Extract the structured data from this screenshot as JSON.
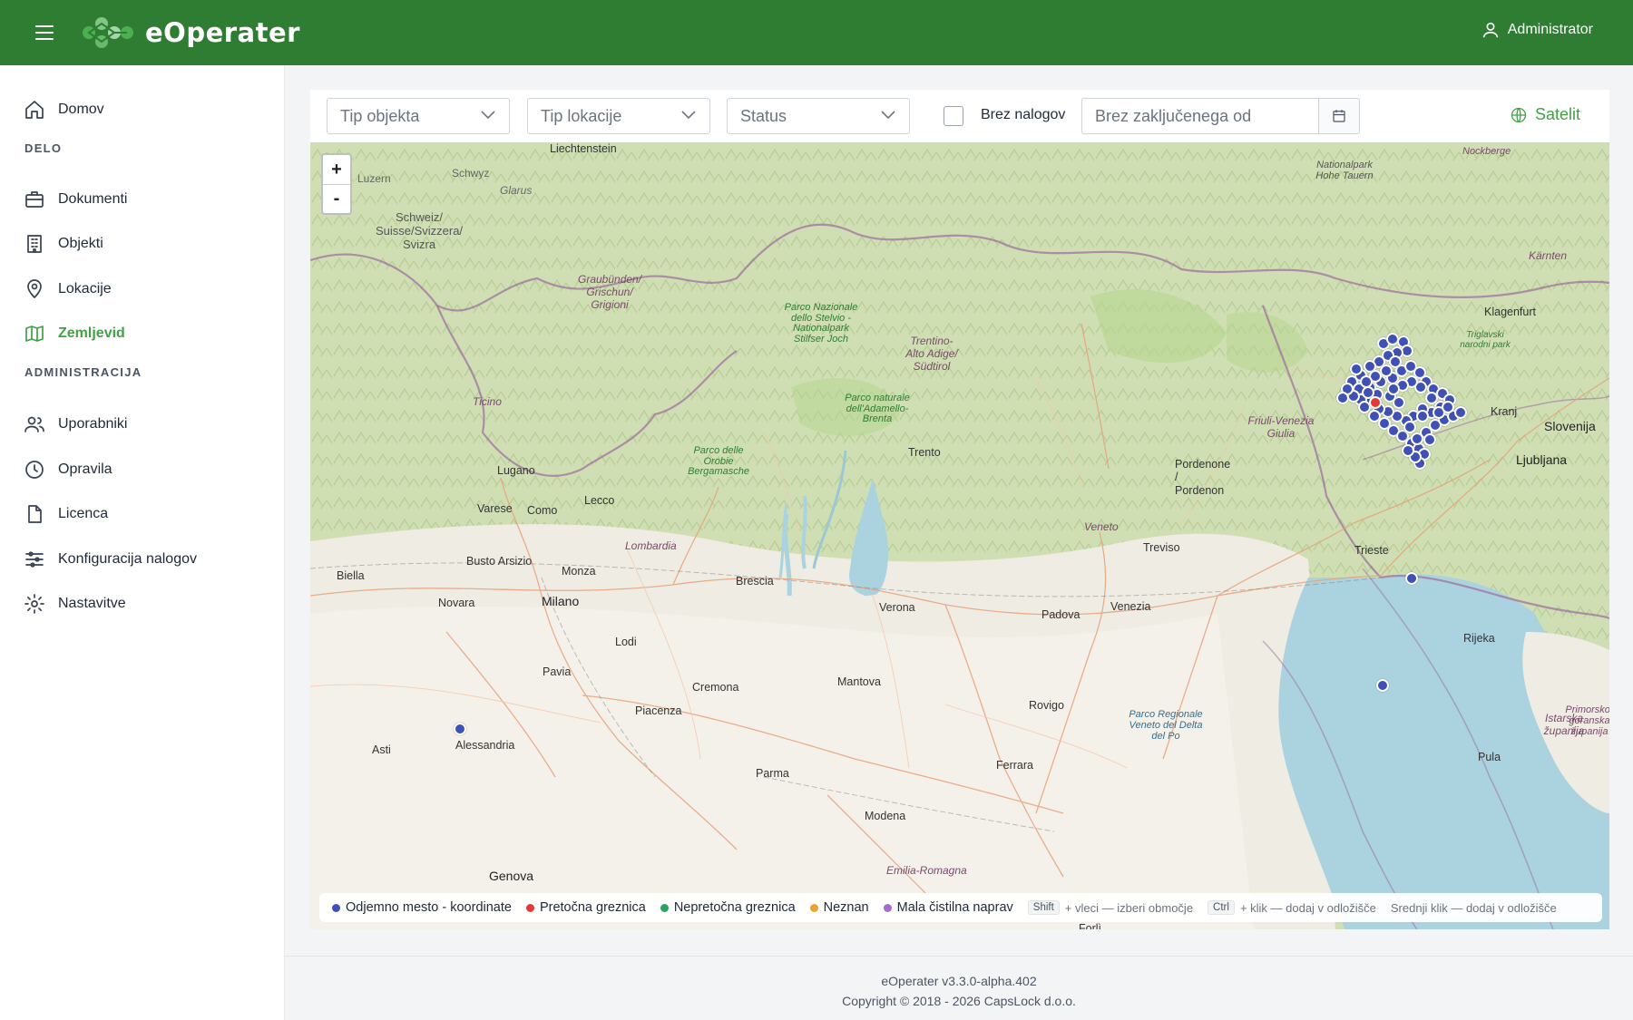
{
  "header": {
    "brand": "eOperater",
    "user": "Administrator"
  },
  "sidebar": {
    "home": "Domov",
    "section_work": "DELO",
    "work_items": [
      "Dokumenti",
      "Objekti",
      "Lokacije",
      "Zemljevid"
    ],
    "section_admin": "ADMINISTRACIJA",
    "admin_items": [
      "Uporabniki",
      "Opravila",
      "Licenca",
      "Konfiguracija nalogov",
      "Nastavitve"
    ],
    "active": "Zemljevid"
  },
  "filters": {
    "object_type": "Tip objekta",
    "location_type": "Tip lokacije",
    "status": "Status",
    "no_orders_label": "Brez nalogov",
    "no_orders_checked": false,
    "closed_since_placeholder": "Brez zaključenega od",
    "satellite_label": "Satelit"
  },
  "map": {
    "zoom_in": "+",
    "zoom_out": "-",
    "labels": {
      "countries": [
        "Liechtenstein",
        "Schweiz/ Suisse/Svizzera/ Svizra",
        "Slovenija",
        "Istarska županija",
        "Primorsko-goranska županija"
      ],
      "cities": [
        "Milano",
        "Brescia",
        "Verona",
        "Padova",
        "Venezia",
        "Treviso",
        "Trento",
        "Trieste",
        "Ljubljana",
        "Kranj",
        "Klagenfurt",
        "Lugano",
        "Como",
        "Lecco",
        "Varese",
        "Monza",
        "Busto Arsizio",
        "Novara",
        "Biella",
        "Lodi",
        "Pavia",
        "Cremona",
        "Piacenza",
        "Mantova",
        "Parma",
        "Modena",
        "Ferrara",
        "Rovigo",
        "Alessandria",
        "Asti",
        "Genova",
        "Forlì",
        "Rijeka",
        "Pula",
        "Pordenone / Pordenon",
        "Luzern",
        "Glarus",
        "Schwyz",
        "Ticino",
        "Lombardia",
        "Veneto",
        "Emilia-Romagna",
        "Friuli-Venezia Giulia",
        "Kärnten",
        "Nockberge",
        "Trentino- Alto Adige/ Südtirol",
        "Graubünden/ Grischun/ Grigioni"
      ],
      "parks": [
        "Parco Nazionale dello Stelvio - Nationalpark Stilfser Joch",
        "Parco naturale dell'Adamello- Brenta",
        "Parco delle Orobie Bergamasche",
        "Nationalpark Hohe Tauern",
        "Parco Regionale Veneto del Delta del Po",
        "Triglavski narodni park"
      ]
    },
    "markers": [
      {
        "type": "Odjemno mesto - koordinate",
        "color": "#3f51b5",
        "count": 1,
        "area": "Alessandria"
      },
      {
        "type": "Odjemno mesto - koordinate",
        "color": "#3f51b5",
        "count": 1,
        "area": "Trieste"
      },
      {
        "type": "Odjemno mesto - koordinate",
        "color": "#3f51b5",
        "count": 1,
        "area": "Istria"
      },
      {
        "type": "Odjemno mesto - koordinate",
        "color": "#3f51b5",
        "count": 70,
        "area": "Soča cluster"
      },
      {
        "type": "Pretočna greznica",
        "color": "#e53935",
        "count": 1,
        "area": "Soča cluster"
      }
    ],
    "legend": [
      {
        "label": "Odjemno mesto - koordinate",
        "color": "#3f51b5"
      },
      {
        "label": "Pretočna greznica",
        "color": "#e53935"
      },
      {
        "label": "Nepretočna greznica",
        "color": "#26a65b"
      },
      {
        "label": "Neznan",
        "color": "#f0a030"
      },
      {
        "label": "Mala čistilna naprav",
        "color": "#a66bd3"
      }
    ],
    "hints": {
      "shift_key": "Shift",
      "shift_text": "+ vleci — izberi območje",
      "ctrl_key": "Ctrl",
      "ctrl_text": "+ klik — dodaj v odložišče",
      "middle_text": "Srednji klik — dodaj v odložišče"
    }
  },
  "footer": {
    "version": "eOperater v3.3.0-alpha.402",
    "copyright": "Copyright © 2018 - 2026 CapsLock d.o.o."
  },
  "colors": {
    "header": "#2e7d32",
    "accent": "#43a047",
    "marker_blue": "#3f51b5",
    "marker_red": "#e53935"
  }
}
